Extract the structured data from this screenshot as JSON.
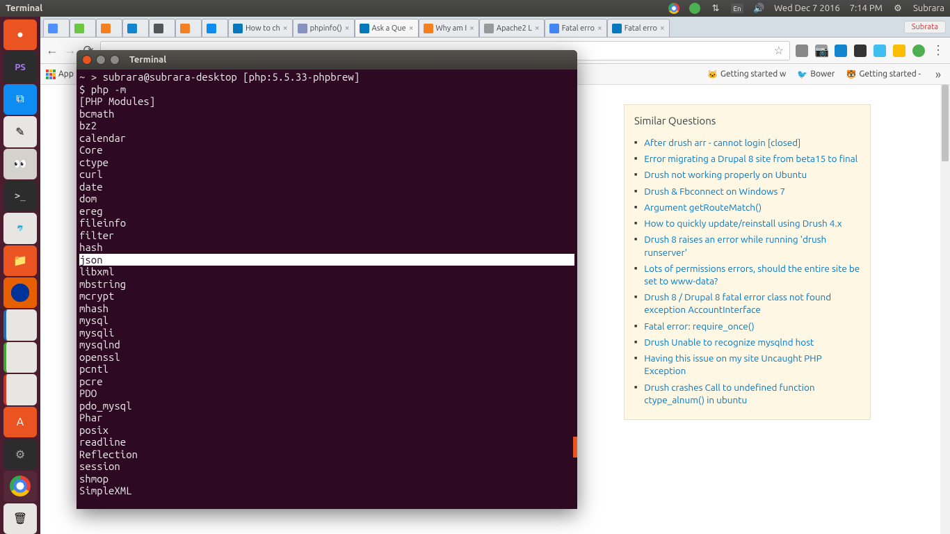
{
  "topbar": {
    "app": "Terminal",
    "lang": "En",
    "date": "Wed Dec  7 2016",
    "time": "7:14 PM",
    "user": "Subrara"
  },
  "tabs": [
    {
      "label": "",
      "icon_bg": "#4d90fe"
    },
    {
      "label": "",
      "icon_bg": "#6cc644"
    },
    {
      "label": "",
      "icon_bg": "#f48024"
    },
    {
      "label": "",
      "icon_bg": "#1285ce"
    },
    {
      "label": "",
      "icon_bg": "#555"
    },
    {
      "label": "",
      "icon_bg": "#f48024"
    },
    {
      "label": "",
      "icon_bg": "#0e8cf1"
    },
    {
      "label": "How to ch",
      "icon_bg": "#0678be",
      "close": true
    },
    {
      "label": "phpinfo()",
      "icon_bg": "#8892bf",
      "close": true
    },
    {
      "label": "Ask a Que",
      "icon_bg": "#0678be",
      "close": true,
      "active": true
    },
    {
      "label": "Why am I",
      "icon_bg": "#f48024",
      "close": true
    },
    {
      "label": "Apache2 L",
      "icon_bg": "#999",
      "close": true
    },
    {
      "label": "Fatal erro",
      "icon_bg": "#4285f4",
      "close": true
    },
    {
      "label": "Fatal erro",
      "icon_bg": "#0678be",
      "close": true
    }
  ],
  "tab_user": "Subrata",
  "bookmarks": [
    {
      "label": "App"
    },
    {
      "label": "Getting started w"
    },
    {
      "label": "Bower"
    },
    {
      "label": "Getting started -"
    }
  ],
  "sidebar": {
    "title": "Similar Questions",
    "items": [
      "After drush arr - cannot login [closed]",
      "Error migrating a Drupal 8 site from beta15 to final",
      "Drush not working properly on Ubuntu",
      "Drush & Fbconnect on Windows 7",
      "Argument getRouteMatch()",
      "How to quickly update/reinstall using Drush 4.x",
      "Drush 8 raises an error while running 'drush runserver'",
      "Lots of permissions errors, should the entire site be set to www-data?",
      "Drush 8 / Drupal 8 fatal error class not found exception AccountInterface",
      "Fatal error: require_once()",
      "Drush Unable to recognize mysqlnd host",
      "Having this issue on my site Uncaught PHP Exception",
      "Drush crashes Call to undefined function ctype_alnum() in ubuntu"
    ]
  },
  "terminal": {
    "title": "Terminal",
    "lines": [
      {
        "t": "~ > subrara@subrara-desktop [php:5.5.33-phpbrew]"
      },
      {
        "t": "$ php -m"
      },
      {
        "t": "[PHP Modules]"
      },
      {
        "t": "bcmath"
      },
      {
        "t": "bz2"
      },
      {
        "t": "calendar"
      },
      {
        "t": "Core"
      },
      {
        "t": "ctype"
      },
      {
        "t": "curl"
      },
      {
        "t": "date"
      },
      {
        "t": "dom"
      },
      {
        "t": "ereg"
      },
      {
        "t": "fileinfo"
      },
      {
        "t": "filter"
      },
      {
        "t": "hash"
      },
      {
        "t": "json",
        "hl": true
      },
      {
        "t": "libxml"
      },
      {
        "t": "mbstring"
      },
      {
        "t": "mcrypt"
      },
      {
        "t": "mhash"
      },
      {
        "t": "mysql"
      },
      {
        "t": "mysqli"
      },
      {
        "t": "mysqlnd"
      },
      {
        "t": "openssl"
      },
      {
        "t": "pcntl"
      },
      {
        "t": "pcre"
      },
      {
        "t": "PDO"
      },
      {
        "t": "pdo_mysql"
      },
      {
        "t": "Phar"
      },
      {
        "t": "posix"
      },
      {
        "t": "readline"
      },
      {
        "t": "Reflection"
      },
      {
        "t": "session"
      },
      {
        "t": "shmop"
      },
      {
        "t": "SimpleXML"
      }
    ]
  }
}
